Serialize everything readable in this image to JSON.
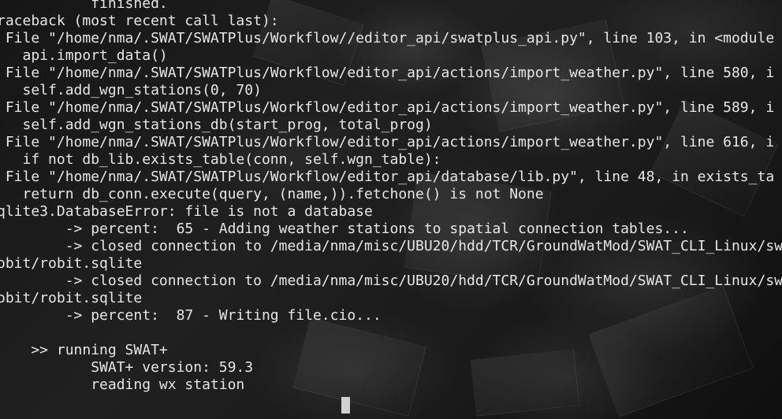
{
  "terminal": {
    "lines": [
      "           finished.",
      "raceback (most recent call last):",
      " File \"/home/nma/.SWAT/SWATPlus/Workflow//editor_api/swatplus_api.py\", line 103, in <module",
      "   api.import_data()",
      " File \"/home/nma/.SWAT/SWATPlus/Workflow/editor_api/actions/import_weather.py\", line 580, i",
      "   self.add_wgn_stations(0, 70)",
      " File \"/home/nma/.SWAT/SWATPlus/Workflow/editor_api/actions/import_weather.py\", line 589, i",
      "   self.add_wgn_stations_db(start_prog, total_prog)",
      " File \"/home/nma/.SWAT/SWATPlus/Workflow/editor_api/actions/import_weather.py\", line 616, i",
      "   if not db_lib.exists_table(conn, self.wgn_table):",
      " File \"/home/nma/.SWAT/SWATPlus/Workflow/editor_api/database/lib.py\", line 48, in exists_ta",
      "   return db_conn.execute(query, (name,)).fetchone() is not None",
      "qlite3.DatabaseError: file is not a database",
      "        -> percent:  65 - Adding weather stations to spatial connection tables...",
      "        -> closed connection to /media/nma/misc/UBU20/hdd/TCR/GroundWatMod/SWAT_CLI_Linux/sw",
      "obit/robit.sqlite",
      "        -> closed connection to /media/nma/misc/UBU20/hdd/TCR/GroundWatMod/SWAT_CLI_Linux/sw",
      "obit/robit.sqlite",
      "        -> percent:  87 - Writing file.cio...",
      "",
      "    >> running SWAT+",
      "           SWAT+ version: 59.3",
      "           reading wx station"
    ]
  }
}
